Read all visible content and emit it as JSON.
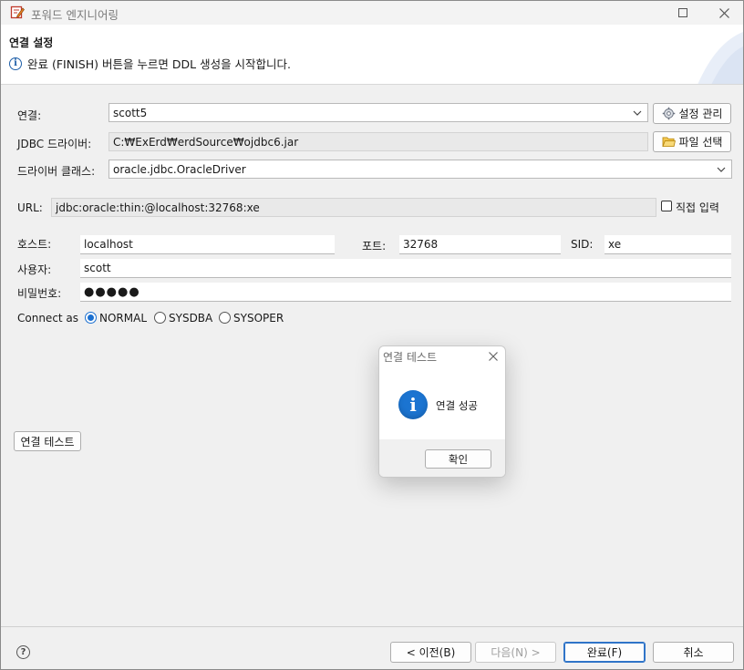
{
  "window": {
    "title": "포워드 엔지니어링"
  },
  "banner": {
    "title": "연결 설정",
    "message": "완료 (FINISH) 버튼을 누르면 DDL 생성을 시작합니다."
  },
  "form": {
    "connection_label": "연결:",
    "connection_value": "scott5",
    "manage_settings_label": "설정 관리",
    "jdbc_driver_label": "JDBC 드라이버:",
    "jdbc_driver_value": "C:₩ExErd₩erdSource₩ojdbc6.jar",
    "file_select_label": "파일 선택",
    "driver_class_label": "드라이버 클래스:",
    "driver_class_value": "oracle.jdbc.OracleDriver",
    "url_label": "URL:",
    "url_value": "jdbc:oracle:thin:@localhost:32768:xe",
    "direct_input_label": "직접 입력",
    "direct_input_checked": false,
    "host_label": "호스트:",
    "host_value": "localhost",
    "port_label": "포트:",
    "port_value": "32768",
    "sid_label": "SID:",
    "sid_value": "xe",
    "user_label": "사용자:",
    "user_value": "scott",
    "password_label": "비밀번호:",
    "password_value": "●●●●●",
    "connect_as_label": "Connect as",
    "connect_as_options": [
      "NORMAL",
      "SYSDBA",
      "SYSOPER"
    ],
    "connect_as_selected": "NORMAL",
    "test_connection_label": "연결 테스트"
  },
  "footer": {
    "back_label": "< 이전(B)",
    "next_label": "다음(N) >",
    "finish_label": "완료(F)",
    "cancel_label": "취소"
  },
  "dialog": {
    "title": "연결 테스트",
    "message": "연결 성공",
    "ok_label": "확인"
  },
  "colors": {
    "accent": "#1b74d1",
    "background": "#f0f0f0",
    "field_readonly": "#e9e9e9"
  },
  "icons": [
    "app-edit-icon",
    "maximize-icon",
    "close-icon",
    "info-icon",
    "gear-icon",
    "folder-icon",
    "chevron-down-icon",
    "help-icon"
  ]
}
